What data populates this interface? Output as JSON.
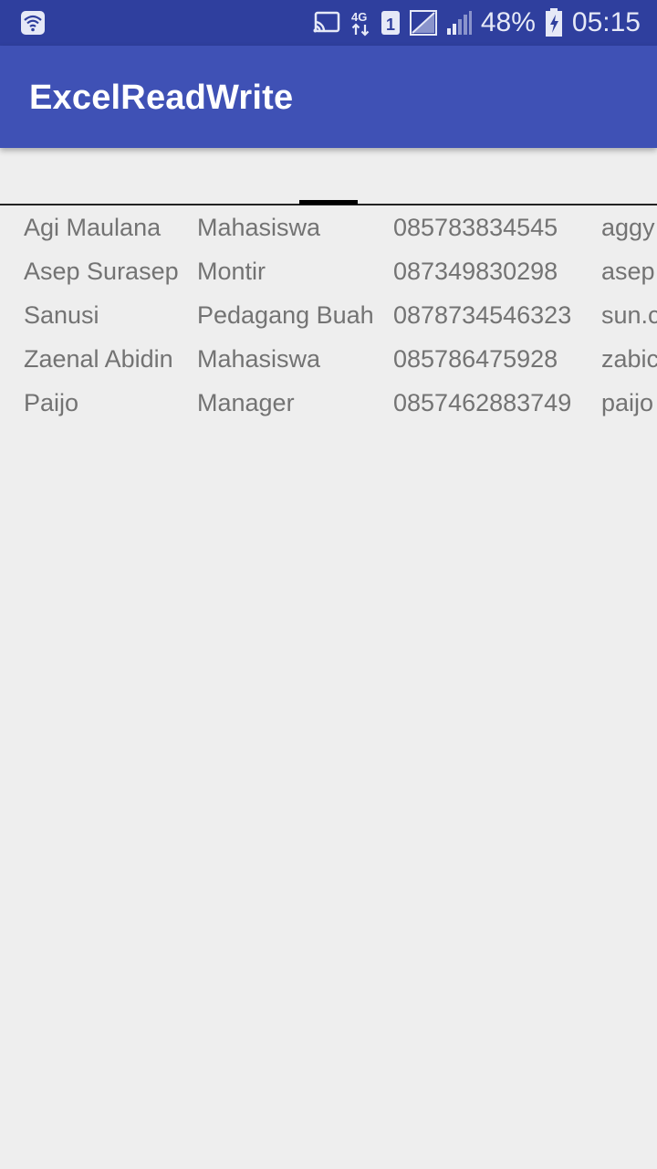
{
  "status_bar": {
    "battery": "48%",
    "time": "05:15",
    "network_label": "4G",
    "sim_label": "1",
    "icons": [
      "wifi-icon",
      "cast-icon",
      "network-4g-icon",
      "sim-icon",
      "signal-icon",
      "battery-icon"
    ]
  },
  "app_bar": {
    "title": "ExcelReadWrite",
    "color": "#3f51b5"
  },
  "table": {
    "rows": [
      [
        "Agi Maulana",
        "Mahasiswa",
        "085783834545",
        "aggy"
      ],
      [
        "Asep Surasep",
        "Montir",
        "087349830298",
        "asep"
      ],
      [
        "Sanusi",
        "Pedagang Buah",
        "0878734546323",
        "sun.c"
      ],
      [
        "Zaenal Abidin",
        "Mahasiswa",
        "085786475928",
        "zabic"
      ],
      [
        "Paijo",
        "Manager",
        "0857462883749",
        "paijo"
      ]
    ]
  }
}
